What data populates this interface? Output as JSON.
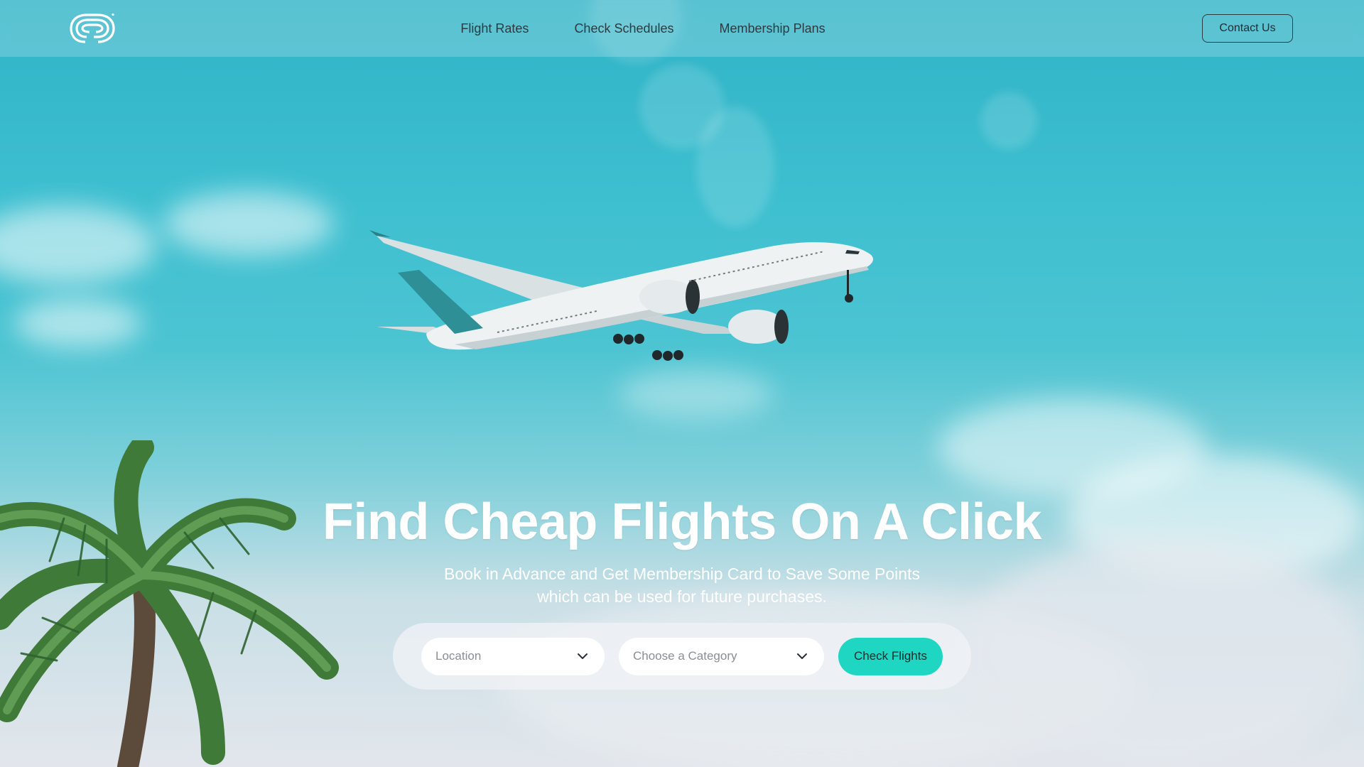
{
  "nav": {
    "logo_name": "brand-logo",
    "links": [
      "Flight Rates",
      "Check Schedules",
      "Membership Plans"
    ],
    "contact_label": "Contact Us"
  },
  "hero": {
    "title": "Find Cheap Flights On A Click",
    "subtitle_line1": "Book in Advance and Get Membership Card to Save Some Points",
    "subtitle_line2": "which can be used for future purchases."
  },
  "search": {
    "location_placeholder": "Location",
    "category_placeholder": "Choose a Category",
    "cta_label": "Check Flights"
  },
  "colors": {
    "accent": "#1fd6c2",
    "sky": "#3dbfd0",
    "text_light": "#ffffff",
    "nav_text": "#2d3b40"
  },
  "icons": [
    "brand-logo",
    "chevron-down-icon"
  ]
}
